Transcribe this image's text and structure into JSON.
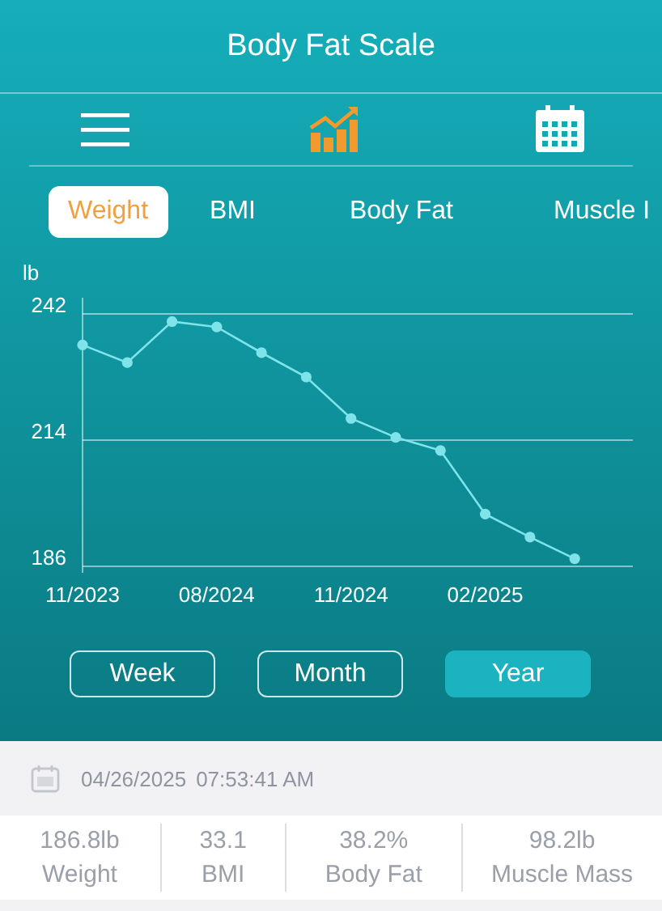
{
  "header": {
    "title": "Body Fat Scale"
  },
  "toolbar": [
    {
      "kind": "menu",
      "selected": false
    },
    {
      "kind": "chart",
      "selected": true
    },
    {
      "kind": "calendar",
      "selected": false
    }
  ],
  "tabs": [
    {
      "label": "Weight",
      "selected": true
    },
    {
      "label": "BMI",
      "selected": false
    },
    {
      "label": "Body Fat",
      "selected": false
    },
    {
      "label": "Muscle I",
      "selected": false
    }
  ],
  "chart_data": {
    "type": "line",
    "ylabel": "lb",
    "categories": [
      "11/2023",
      null,
      null,
      "08/2024",
      null,
      null,
      "11/2024",
      null,
      null,
      "02/2025",
      null,
      null
    ],
    "series": [
      {
        "color": "#7fe3ea",
        "marker": "circle",
        "values": [
          235.1,
          231.2,
          240.3,
          239.1,
          233.4,
          228.0,
          218.8,
          214.6,
          211.7,
          197.6,
          192.5,
          187.7
        ]
      }
    ],
    "ylim": [
      186,
      242
    ],
    "yticks": [
      186,
      214,
      242
    ]
  },
  "periods": [
    {
      "label": "Week",
      "selected": false
    },
    {
      "label": "Month",
      "selected": false
    },
    {
      "label": "Year",
      "selected": true
    }
  ],
  "record": {
    "date": "04/26/2025",
    "time": "07:53:41 AM"
  },
  "stats": [
    {
      "value": "186.8lb",
      "label": "Weight"
    },
    {
      "value": "33.1",
      "label": "BMI"
    },
    {
      "value": "38.2%",
      "label": "Body Fat"
    },
    {
      "value": "98.2lb",
      "label": "Muscle Mass"
    }
  ]
}
